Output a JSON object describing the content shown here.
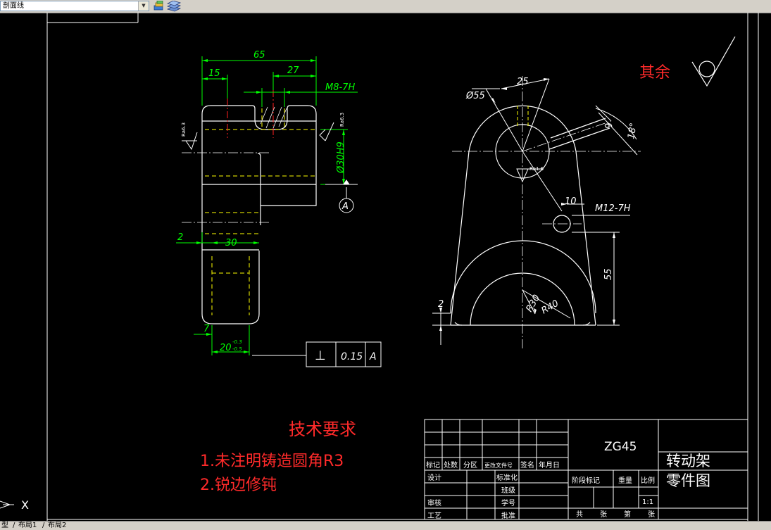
{
  "toolbar": {
    "layer_value": "剖面线",
    "icons": [
      "layer-properties-icon",
      "layer-states-icon"
    ]
  },
  "drawing": {
    "left_view": {
      "dims": {
        "d65": "65",
        "d15": "15",
        "d27": "27",
        "m8": "M8-7H",
        "bore": "Ø30H9",
        "datum": "A",
        "d2": "2",
        "d30": "30",
        "d7": "7",
        "d20": "20",
        "tol_upper": "-0.3",
        "tol_lower": "-0.5",
        "rough_left": "Ra6.3",
        "rough_right": "Ra6.3"
      },
      "frame": {
        "symbol": "⊥",
        "value": "0.15",
        "datum": "A"
      }
    },
    "front_view": {
      "dims": {
        "d55": "Ø55",
        "d25": "25",
        "d6": "6",
        "d18": "18°",
        "ra": "Ra1.6",
        "d10": "10",
        "m12": "M12-7H",
        "d55v": "55",
        "r30": "R30",
        "r40": "R40",
        "d2": "2"
      }
    },
    "rest_roughness_label": "其余",
    "tech_requirements": {
      "title": "技术要求",
      "items": [
        "1.未注明铸造圆角R3",
        "2.锐边修钝"
      ]
    },
    "title_block": {
      "material": "ZG45",
      "part_name_line1": "转动架",
      "part_name_line2": "零件图",
      "header_cells": [
        "标记",
        "处数",
        "分区",
        "更改文件号",
        "签名",
        "年月日"
      ],
      "left_labels": [
        "设计",
        "审核",
        "工艺"
      ],
      "mid_labels": [
        "标准化",
        "班级",
        "学号",
        "批准"
      ],
      "stage_labels": [
        "阶段标记",
        "重量",
        "比例"
      ],
      "scale": "1:1",
      "sheet_labels": [
        "共",
        "张",
        "第",
        "张"
      ]
    },
    "ucs_label": "X"
  },
  "layout_tabs": [
    "型",
    "布局1",
    "布局2"
  ],
  "colors": {
    "background": "#000000",
    "geometry": "#ffffff",
    "dimension": "#00ff00",
    "hidden": "#ffff00",
    "center": "#ff0000",
    "annotation": "#ff2a2a"
  }
}
